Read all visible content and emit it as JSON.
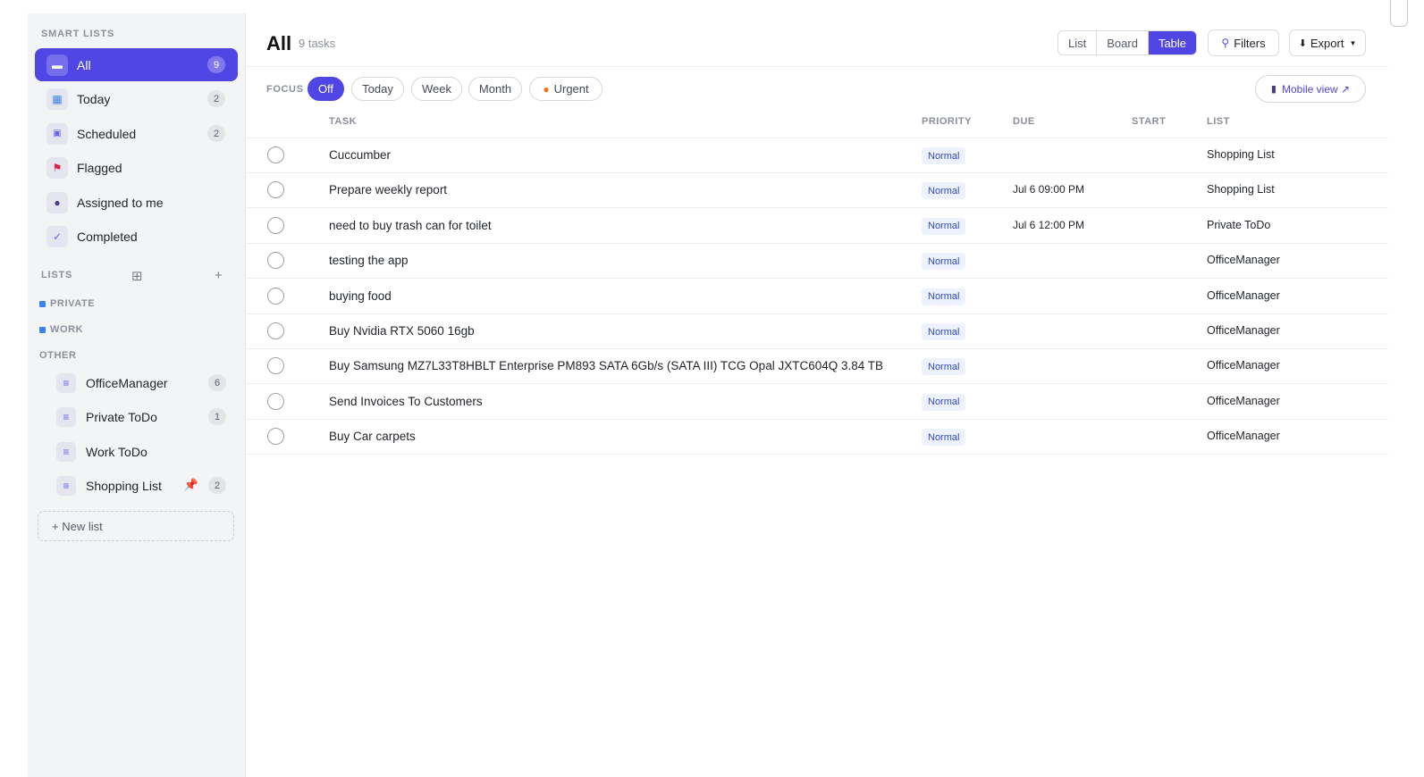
{
  "sidebar": {
    "smart_lists_title": "SMART LISTS",
    "smart_items": [
      {
        "label": "All",
        "count": "9",
        "icon": "folder-icon"
      },
      {
        "label": "Today",
        "count": "2",
        "icon": "calendar-icon"
      },
      {
        "label": "Scheduled",
        "count": "2",
        "icon": "scheduled-icon"
      },
      {
        "label": "Flagged",
        "count": "",
        "icon": "flag-icon"
      },
      {
        "label": "Assigned to me",
        "count": "",
        "icon": "person-icon"
      },
      {
        "label": "Completed",
        "count": "",
        "icon": "check-icon"
      }
    ],
    "lists_title": "LISTS",
    "groups": {
      "private": "PRIVATE",
      "work": "WORK",
      "other": "OTHER"
    },
    "lists": [
      {
        "label": "OfficeManager",
        "count": "6"
      },
      {
        "label": "Private ToDo",
        "count": "1"
      },
      {
        "label": "Work ToDo",
        "count": ""
      },
      {
        "label": "Shopping List",
        "count": "2"
      }
    ],
    "new_list_label": "+ New list"
  },
  "header": {
    "title": "All",
    "count": "9 tasks",
    "views": [
      "List",
      "Board",
      "Table"
    ],
    "active_view": "Table",
    "filters_label": "Filters",
    "export_label": "Export"
  },
  "focus": {
    "label": "FOCUS",
    "chips": [
      "Off",
      "Today",
      "Week",
      "Month",
      "Urgent"
    ],
    "active": "Off",
    "mobile_view_label": "Mobile view ↗"
  },
  "table": {
    "columns": [
      "TASK",
      "PRIORITY",
      "DUE",
      "START",
      "LIST"
    ],
    "rows": [
      {
        "task": "Cuccumber",
        "priority": "Normal",
        "due": "",
        "start": "",
        "list": "Shopping List"
      },
      {
        "task": "Prepare weekly report",
        "priority": "Normal",
        "due": "Jul 6 09:00 PM",
        "start": "",
        "list": "Shopping List"
      },
      {
        "task": "need to buy trash can for toilet",
        "priority": "Normal",
        "due": "Jul 6 12:00 PM",
        "start": "",
        "list": "Private ToDo"
      },
      {
        "task": "testing the app",
        "priority": "Normal",
        "due": "",
        "start": "",
        "list": "OfficeManager"
      },
      {
        "task": "buying food",
        "priority": "Normal",
        "due": "",
        "start": "",
        "list": "OfficeManager"
      },
      {
        "task": "Buy Nvidia RTX 5060 16gb",
        "priority": "Normal",
        "due": "",
        "start": "",
        "list": "OfficeManager"
      },
      {
        "task": "Buy Samsung MZ7L33T8HBLT Enterprise PM893 SATA 6Gb/s (SATA III) TCG Opal JXTC604Q 3.84 TB",
        "priority": "Normal",
        "due": "",
        "start": "",
        "list": "OfficeManager"
      },
      {
        "task": "Send Invoices To Customers",
        "priority": "Normal",
        "due": "",
        "start": "",
        "list": "OfficeManager"
      },
      {
        "task": "Buy Car carpets",
        "priority": "Normal",
        "due": "",
        "start": "",
        "list": "OfficeManager"
      }
    ]
  },
  "colors": {
    "accent": "#4f46e5",
    "priority_bg": "#eef2ff",
    "priority_text": "#2f4ac8"
  }
}
